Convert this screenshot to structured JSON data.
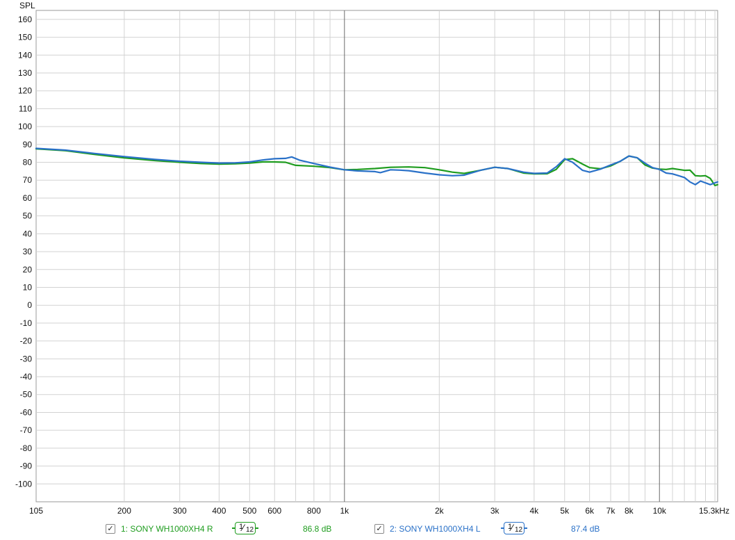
{
  "chart_data": {
    "type": "line",
    "ylabel": "SPL",
    "ylim": [
      -110,
      165
    ],
    "y_ticks": [
      160,
      150,
      140,
      130,
      120,
      110,
      100,
      90,
      80,
      70,
      60,
      50,
      40,
      30,
      20,
      10,
      0,
      -10,
      -20,
      -30,
      -40,
      -50,
      -60,
      -70,
      -80,
      -90,
      -100
    ],
    "x_scale": "log",
    "xlim": [
      105,
      15300
    ],
    "x_ticks": [
      {
        "value": 105,
        "label": "105"
      },
      {
        "value": 200,
        "label": "200"
      },
      {
        "value": 300,
        "label": "300"
      },
      {
        "value": 400,
        "label": "400"
      },
      {
        "value": 500,
        "label": "500"
      },
      {
        "value": 600,
        "label": "600"
      },
      {
        "value": 800,
        "label": "800"
      },
      {
        "value": 1000,
        "label": "1k"
      },
      {
        "value": 2000,
        "label": "2k"
      },
      {
        "value": 3000,
        "label": "3k"
      },
      {
        "value": 4000,
        "label": "4k"
      },
      {
        "value": 5000,
        "label": "5k"
      },
      {
        "value": 6000,
        "label": "6k"
      },
      {
        "value": 7000,
        "label": "7k"
      },
      {
        "value": 8000,
        "label": "8k"
      },
      {
        "value": 10000,
        "label": "10k"
      },
      {
        "value": 15300,
        "label": "15.3kHz"
      }
    ],
    "grid": true,
    "legend_position": "bottom",
    "series": [
      {
        "name": "1: SONY WH1000XH4  R",
        "color": "#1e9c1e",
        "smoothing": {
          "num": "1",
          "den": "12"
        },
        "level": "86.8 dB",
        "points": [
          [
            105,
            87.5
          ],
          [
            130,
            86.5
          ],
          [
            160,
            84.5
          ],
          [
            200,
            82.5
          ],
          [
            250,
            81
          ],
          [
            300,
            80
          ],
          [
            350,
            79.3
          ],
          [
            400,
            79
          ],
          [
            450,
            79.2
          ],
          [
            500,
            79.6
          ],
          [
            550,
            80.2
          ],
          [
            600,
            80.2
          ],
          [
            650,
            80
          ],
          [
            700,
            78.3
          ],
          [
            800,
            77.8
          ],
          [
            900,
            77
          ],
          [
            1000,
            75.8
          ],
          [
            1100,
            76
          ],
          [
            1250,
            76.5
          ],
          [
            1400,
            77.2
          ],
          [
            1600,
            77.4
          ],
          [
            1800,
            77
          ],
          [
            2000,
            75.8
          ],
          [
            2200,
            74.5
          ],
          [
            2400,
            73.8
          ],
          [
            2700,
            75.5
          ],
          [
            3000,
            77.2
          ],
          [
            3300,
            76.5
          ],
          [
            3700,
            74
          ],
          [
            4000,
            73.5
          ],
          [
            4400,
            73.6
          ],
          [
            4700,
            76
          ],
          [
            5000,
            81.5
          ],
          [
            5300,
            82
          ],
          [
            5700,
            79
          ],
          [
            6000,
            77
          ],
          [
            6500,
            76.4
          ],
          [
            7000,
            78
          ],
          [
            7500,
            80.5
          ],
          [
            8000,
            83.5
          ],
          [
            8500,
            82.5
          ],
          [
            9000,
            78.5
          ],
          [
            9500,
            76.8
          ],
          [
            10000,
            76.2
          ],
          [
            10500,
            76
          ],
          [
            11000,
            76.5
          ],
          [
            11500,
            76
          ],
          [
            12000,
            75.5
          ],
          [
            12500,
            75.6
          ],
          [
            13000,
            72.5
          ],
          [
            13500,
            72.3
          ],
          [
            14000,
            72.5
          ],
          [
            14500,
            71
          ],
          [
            15000,
            67
          ],
          [
            15300,
            67.5
          ]
        ]
      },
      {
        "name": "2: SONY WH1000XH4  L",
        "color": "#2a71c8",
        "smoothing": {
          "num": "1",
          "den": "12"
        },
        "level": "87.4 dB",
        "points": [
          [
            105,
            87.8
          ],
          [
            130,
            86.8
          ],
          [
            160,
            85
          ],
          [
            200,
            83.2
          ],
          [
            250,
            81.6
          ],
          [
            300,
            80.6
          ],
          [
            350,
            80
          ],
          [
            400,
            79.6
          ],
          [
            450,
            79.7
          ],
          [
            500,
            80.2
          ],
          [
            550,
            81.3
          ],
          [
            600,
            82
          ],
          [
            650,
            82.2
          ],
          [
            680,
            83
          ],
          [
            720,
            81.2
          ],
          [
            800,
            79.3
          ],
          [
            900,
            77.3
          ],
          [
            1000,
            75.8
          ],
          [
            1100,
            75.2
          ],
          [
            1250,
            74.8
          ],
          [
            1300,
            74.2
          ],
          [
            1400,
            75.8
          ],
          [
            1500,
            75.6
          ],
          [
            1600,
            75.3
          ],
          [
            1800,
            74
          ],
          [
            2000,
            73
          ],
          [
            2200,
            72.5
          ],
          [
            2400,
            72.8
          ],
          [
            2700,
            75.5
          ],
          [
            3000,
            77.2
          ],
          [
            3300,
            76.5
          ],
          [
            3700,
            74.5
          ],
          [
            4000,
            73.8
          ],
          [
            4400,
            74
          ],
          [
            4700,
            77.5
          ],
          [
            5000,
            82
          ],
          [
            5300,
            80
          ],
          [
            5700,
            75.5
          ],
          [
            6000,
            74.5
          ],
          [
            6500,
            76.2
          ],
          [
            7000,
            78.5
          ],
          [
            7500,
            80.5
          ],
          [
            8000,
            83.5
          ],
          [
            8500,
            82.5
          ],
          [
            9000,
            79.5
          ],
          [
            9500,
            77
          ],
          [
            10000,
            76
          ],
          [
            10500,
            74
          ],
          [
            11000,
            73.5
          ],
          [
            11500,
            72.5
          ],
          [
            12000,
            71.5
          ],
          [
            12500,
            69
          ],
          [
            13000,
            67.5
          ],
          [
            13500,
            69.5
          ],
          [
            14000,
            68.5
          ],
          [
            14500,
            67.5
          ],
          [
            15000,
            68.5
          ],
          [
            15300,
            69
          ]
        ]
      }
    ]
  }
}
